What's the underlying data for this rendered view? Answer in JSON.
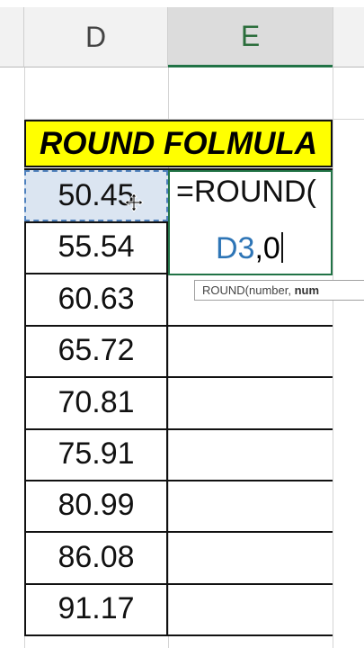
{
  "columns": {
    "d": "D",
    "e": "E"
  },
  "title": "ROUND FOLMULA",
  "values": [
    "50.45",
    "55.54",
    "60.63",
    "65.72",
    "70.81",
    "75.91",
    "80.99",
    "86.08",
    "91.17"
  ],
  "formula": {
    "line1": "=ROUND(",
    "ref": "D3",
    "rest": ",0"
  },
  "tooltip": {
    "prefix": "ROUND(number, ",
    "bold": "num"
  },
  "colors": {
    "title_bg": "#ffff00",
    "selected_bg": "#dbe5f1",
    "ref": "#2e75b6",
    "accent": "#217346"
  }
}
